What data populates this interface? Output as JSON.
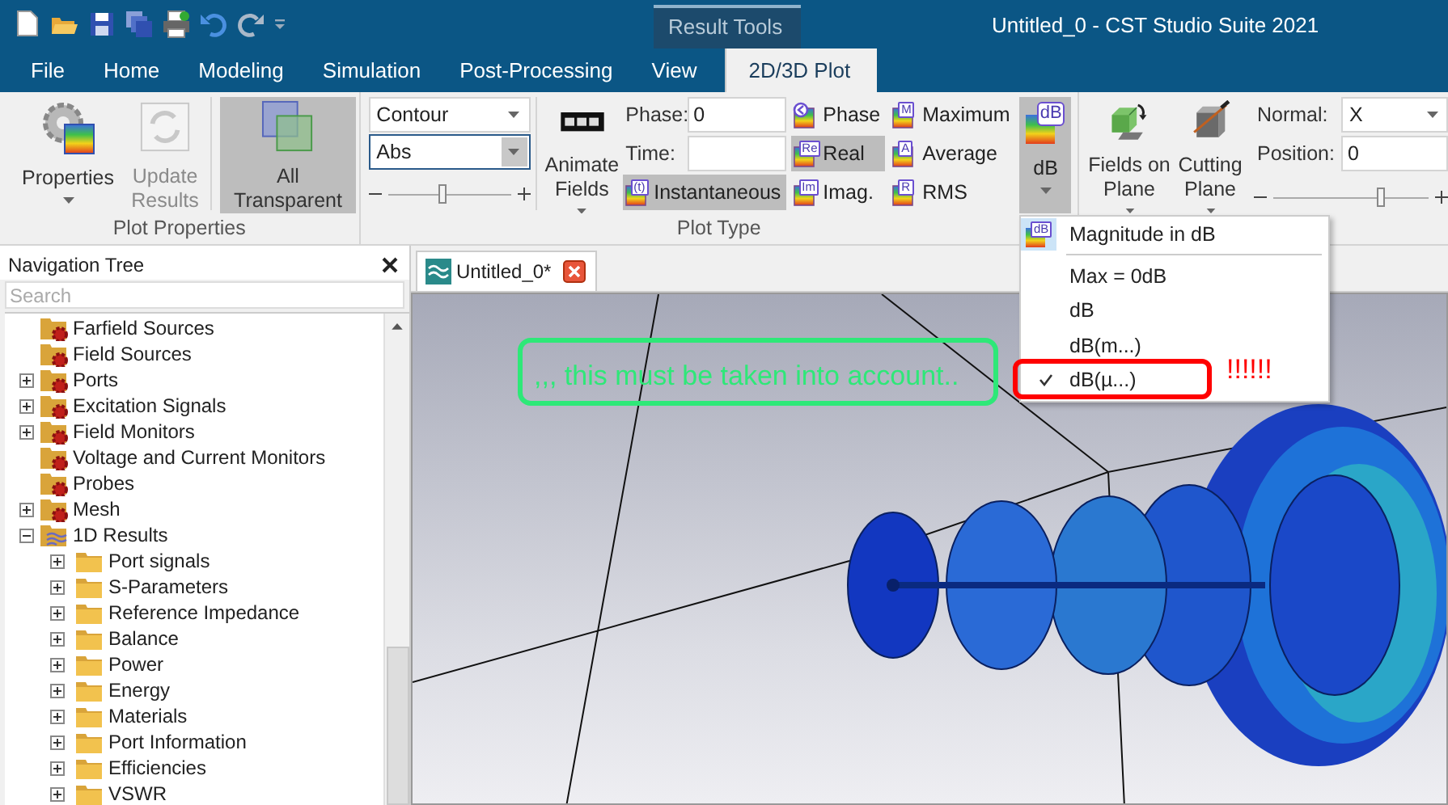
{
  "window": {
    "title": "Untitled_0 - CST Studio Suite 2021",
    "context_group": "Result Tools"
  },
  "menu_tabs": [
    {
      "label": "File",
      "selected": false
    },
    {
      "label": "Home",
      "selected": false
    },
    {
      "label": "Modeling",
      "selected": false
    },
    {
      "label": "Simulation",
      "selected": false
    },
    {
      "label": "Post-Processing",
      "selected": false
    },
    {
      "label": "View",
      "selected": false
    },
    {
      "label": "2D/3D Plot",
      "selected": true
    }
  ],
  "plot_properties": {
    "label": "Plot Properties",
    "properties": {
      "label": "Properties"
    },
    "update_results": {
      "label": "Update Results",
      "disabled": true
    },
    "all_transparent": {
      "label": "All Transparent",
      "pressed": true
    },
    "plot_mode": {
      "value": "Contour"
    },
    "component": {
      "value": "Abs",
      "focused": true
    },
    "slider": {
      "level": 0.45
    }
  },
  "plot_type": {
    "label": "Plot Type",
    "animate": {
      "label": "Animate Fields"
    },
    "phase": {
      "label": "Phase:",
      "value": "0"
    },
    "time": {
      "label": "Time:"
    },
    "buttons": [
      {
        "kind": "instantaneous",
        "label": "Instantaneous",
        "badge": "(t)",
        "selected": true
      },
      {
        "kind": "phase",
        "label": "Phase",
        "selected": false
      },
      {
        "kind": "real",
        "label": "Real",
        "badge": "Re",
        "selected": true
      },
      {
        "kind": "imag",
        "label": "Imag.",
        "badge": "Im",
        "selected": false
      },
      {
        "kind": "max",
        "label": "Maximum",
        "badge": "M",
        "selected": false
      },
      {
        "kind": "avg",
        "label": "Average",
        "badge": "A",
        "selected": false
      },
      {
        "kind": "rms",
        "label": "RMS",
        "badge": "R",
        "selected": false
      }
    ],
    "db": {
      "label": "dB",
      "badge": "dB",
      "pressed": true
    }
  },
  "plane": {
    "fields_on_plane": "Fields on Plane",
    "cutting_plane": "Cutting Plane",
    "normal": {
      "label": "Normal:",
      "value": "X"
    },
    "position": {
      "label": "Position:",
      "value": "0"
    },
    "slider": {
      "level": 0.7
    }
  },
  "db_menu": {
    "header": "Magnitude in dB",
    "header_badge": "dB",
    "items": [
      {
        "label": "Max = 0dB",
        "checked": false
      },
      {
        "label": "dB",
        "checked": false
      },
      {
        "label": "dB(m...)",
        "checked": false
      },
      {
        "label": "dB(µ...)",
        "checked": true
      }
    ]
  },
  "navigation_tree": {
    "title": "Navigation Tree",
    "search": {
      "placeholder": "Search"
    },
    "items": [
      {
        "label": "Farfield Sources",
        "kind": "source"
      },
      {
        "label": "Field Sources",
        "kind": "source"
      },
      {
        "label": "Ports",
        "kind": "source",
        "expanded": false
      },
      {
        "label": "Excitation Signals",
        "kind": "source",
        "expanded": false
      },
      {
        "label": "Field Monitors",
        "kind": "source",
        "expanded": false
      },
      {
        "label": "Voltage and Current Monitors",
        "kind": "source"
      },
      {
        "label": "Probes",
        "kind": "source"
      },
      {
        "label": "Mesh",
        "kind": "source",
        "expanded": false
      },
      {
        "label": "1D Results",
        "kind": "results",
        "expanded": true,
        "children": [
          {
            "label": "Port signals",
            "kind": "folder",
            "expanded": false
          },
          {
            "label": "S-Parameters",
            "kind": "folder",
            "expanded": false
          },
          {
            "label": "Reference Impedance",
            "kind": "folder",
            "expanded": false
          },
          {
            "label": "Balance",
            "kind": "folder",
            "expanded": false
          },
          {
            "label": "Power",
            "kind": "folder",
            "expanded": false
          },
          {
            "label": "Energy",
            "kind": "folder",
            "expanded": false
          },
          {
            "label": "Materials",
            "kind": "folder",
            "expanded": false
          },
          {
            "label": "Port Information",
            "kind": "folder",
            "expanded": false
          },
          {
            "label": "Efficiencies",
            "kind": "folder",
            "expanded": false
          },
          {
            "label": "VSWR",
            "kind": "folder",
            "expanded": false
          }
        ]
      }
    ]
  },
  "document_tab": {
    "label": "Untitled_0*",
    "selected": true
  },
  "annotations": [
    {
      "kind": "note",
      "text": ",,, this must be taken into account.."
    },
    {
      "kind": "highlight"
    },
    {
      "kind": "exclaim",
      "text": "!!!!!!"
    }
  ]
}
